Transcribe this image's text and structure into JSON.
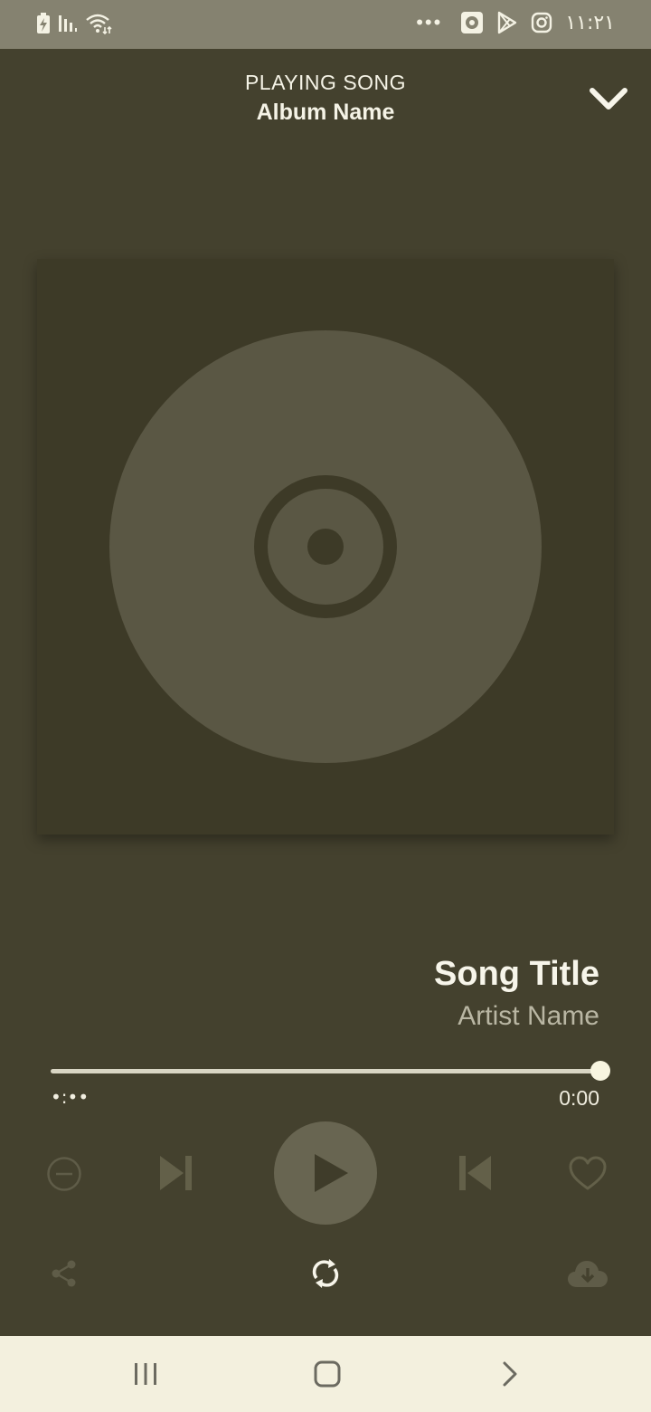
{
  "status_bar": {
    "time": "١١:٢١",
    "overflow_dots": "•••",
    "icons": [
      "battery-charging-icon",
      "signal-icon",
      "wifi-icon",
      "notification-app-icon",
      "play-store-icon",
      "instagram-icon"
    ]
  },
  "header": {
    "label": "PLAYING SONG",
    "album": "Album Name"
  },
  "track": {
    "title": "Song Title",
    "artist": "Artist Name"
  },
  "progress": {
    "elapsed": "•:••",
    "total": "0:00",
    "fraction": 1.0
  },
  "controls": {
    "icons": [
      "remove-circle-icon",
      "skip-next-icon",
      "play-icon",
      "skip-previous-icon",
      "heart-icon",
      "share-icon",
      "repeat-icon",
      "cloud-download-icon"
    ]
  },
  "nav_bar": {
    "icons": [
      "recent-apps-icon",
      "home-icon",
      "back-icon"
    ]
  },
  "colors": {
    "background": "#44412e",
    "status_bar": "#858270",
    "artwork": "#3d3a27",
    "disc": "#5a5744",
    "nav_bar": "#f3f0de"
  }
}
